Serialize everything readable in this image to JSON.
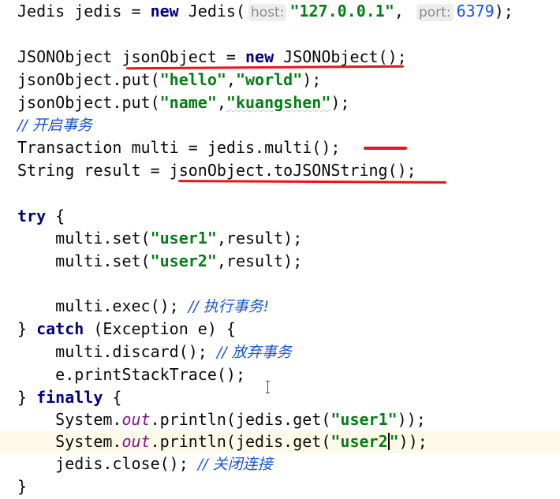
{
  "lines": {
    "l1": {
      "a": "Jedis jedis = ",
      "new": "new",
      "b": " Jedis(",
      "hint_host": "host:",
      "host": "\"127.0.0.1\"",
      "c": ", ",
      "hint_port": "port:",
      "port": "6379",
      "d": ");"
    },
    "l2": {
      "a": "JSONObject jsonObject = ",
      "new": "new",
      "b": " JSONObject();"
    },
    "l3": {
      "a": "jsonObject.put(",
      "k": "\"hello\"",
      "c": ",",
      "v": "\"world\"",
      "d": ");"
    },
    "l4": {
      "a": "jsonObject.put(",
      "k": "\"name\"",
      "c": ",",
      "v": "\"kuangshen\"",
      "d": ");"
    },
    "l5": {
      "cmt": "// 开启事务"
    },
    "l6": {
      "a": "Transaction multi = jedis.multi();"
    },
    "l7": {
      "a": "String result = jsonObject.toJSONString();"
    },
    "l8": {
      "kw": "try",
      "b": " {"
    },
    "l9": {
      "a": "    multi.set(",
      "s": "\"user1\"",
      "b": ",result);"
    },
    "l10": {
      "a": "    multi.set(",
      "s": "\"user2\"",
      "b": ",result);"
    },
    "l11": {
      "a": "    multi.exec(); ",
      "cmt": "// 执行事务!"
    },
    "l12": {
      "a": "} ",
      "kw": "catch",
      "b": " (Exception e) {"
    },
    "l13": {
      "a": "    multi.discard(); ",
      "cmt": "// 放弃事务"
    },
    "l14": {
      "a": "    e.printStackTrace();"
    },
    "l15": {
      "a": "} ",
      "kw": "finally",
      "b": " {"
    },
    "l16": {
      "a": "    System.",
      "fld": "out",
      "b": ".println(jedis.get(",
      "s": "\"user1\"",
      "c": "));"
    },
    "l17": {
      "a": "    System.",
      "fld": "out",
      "b": ".println(jedis.get(",
      "s1": "\"user2",
      "s2": "\"",
      "c": "));"
    },
    "l18": {
      "a": "    jedis.close(); ",
      "cmt": "// 关闭连接"
    },
    "l19": {
      "a": "}"
    }
  },
  "colors": {
    "keyword": "#000080",
    "string": "#067d17",
    "number": "#1750eb",
    "comment": "#1c55c9",
    "static_field": "#871094",
    "annotation": "#e8141c",
    "current_line": "#fdfbe8"
  }
}
